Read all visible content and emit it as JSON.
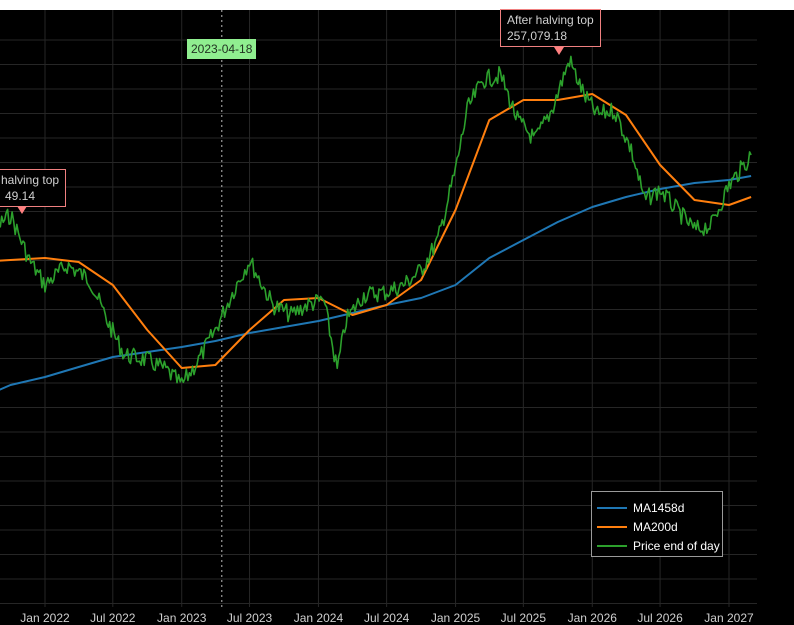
{
  "chart_data": {
    "type": "line",
    "x_ticks": [
      "Jan 2022",
      "Jul 2022",
      "Jan 2023",
      "Jul 2023",
      "Jan 2024",
      "Jul 2024",
      "Jan 2025",
      "Jul 2025",
      "Jan 2026",
      "Jul 2026",
      "Jan 2027"
    ],
    "vertical_marker": {
      "date": "2023-04-18",
      "label": "2023-04-18"
    },
    "annotations": [
      {
        "label": "halving top",
        "value_text": "49.14",
        "name": "left-halving-top"
      },
      {
        "label": "After halving top",
        "value_text": "257,079.18",
        "name": "after-halving-top"
      }
    ],
    "legend": {
      "placement": "bottom-right"
    },
    "grid": true,
    "series": [
      {
        "name": "MA1458d",
        "color": "#1f77b4",
        "points": [
          [
            "2021-07-01",
            400
          ],
          [
            "2021-10-01",
            385
          ],
          [
            "2022-01-01",
            377
          ],
          [
            "2022-04-01",
            367
          ],
          [
            "2022-07-01",
            357
          ],
          [
            "2022-10-01",
            352
          ],
          [
            "2023-01-01",
            347
          ],
          [
            "2023-04-01",
            341
          ],
          [
            "2023-07-01",
            333
          ],
          [
            "2023-10-01",
            327
          ],
          [
            "2024-01-01",
            321
          ],
          [
            "2024-04-01",
            313
          ],
          [
            "2024-07-01",
            305
          ],
          [
            "2024-10-01",
            298
          ],
          [
            "2025-01-01",
            285
          ],
          [
            "2025-04-01",
            258
          ],
          [
            "2025-07-01",
            240
          ],
          [
            "2025-10-01",
            222
          ],
          [
            "2026-01-01",
            207
          ],
          [
            "2026-04-01",
            197
          ],
          [
            "2026-07-01",
            189
          ],
          [
            "2026-10-01",
            183
          ],
          [
            "2027-01-01",
            180
          ],
          [
            "2027-03-01",
            176
          ]
        ]
      },
      {
        "name": "MA200d",
        "color": "#ff7f0e",
        "points": [
          [
            "2021-07-01",
            262
          ],
          [
            "2021-10-01",
            260
          ],
          [
            "2022-01-01",
            258
          ],
          [
            "2022-04-01",
            262
          ],
          [
            "2022-07-01",
            285
          ],
          [
            "2022-10-01",
            330
          ],
          [
            "2023-01-01",
            368
          ],
          [
            "2023-04-01",
            365
          ],
          [
            "2023-07-01",
            330
          ],
          [
            "2023-10-01",
            300
          ],
          [
            "2024-01-01",
            298
          ],
          [
            "2024-04-01",
            315
          ],
          [
            "2024-07-01",
            305
          ],
          [
            "2024-10-01",
            280
          ],
          [
            "2025-01-01",
            210
          ],
          [
            "2025-04-01",
            120
          ],
          [
            "2025-07-01",
            100
          ],
          [
            "2025-10-01",
            100
          ],
          [
            "2026-01-01",
            94
          ],
          [
            "2026-04-01",
            115
          ],
          [
            "2026-07-01",
            165
          ],
          [
            "2026-10-01",
            200
          ],
          [
            "2027-01-01",
            205
          ],
          [
            "2027-03-01",
            197
          ]
        ]
      },
      {
        "name": "Price end of day",
        "color": "#2ca02c",
        "points": [
          [
            "2021-07-01",
            265
          ],
          [
            "2021-08-15",
            230
          ],
          [
            "2021-10-01",
            215
          ],
          [
            "2021-11-20",
            260
          ],
          [
            "2022-01-01",
            285
          ],
          [
            "2022-03-01",
            265
          ],
          [
            "2022-05-01",
            280
          ],
          [
            "2022-06-15",
            320
          ],
          [
            "2022-08-01",
            355
          ],
          [
            "2022-10-01",
            360
          ],
          [
            "2022-11-20",
            370
          ],
          [
            "2023-01-01",
            385
          ],
          [
            "2023-02-15",
            360
          ],
          [
            "2023-04-01",
            330
          ],
          [
            "2023-05-20",
            290
          ],
          [
            "2023-07-01",
            260
          ],
          [
            "2023-09-01",
            305
          ],
          [
            "2023-10-20",
            315
          ],
          [
            "2023-12-01",
            305
          ],
          [
            "2024-01-15",
            300
          ],
          [
            "2024-02-20",
            370
          ],
          [
            "2024-03-15",
            320
          ],
          [
            "2024-05-01",
            295
          ],
          [
            "2024-07-01",
            292
          ],
          [
            "2024-08-15",
            285
          ],
          [
            "2024-10-01",
            270
          ],
          [
            "2024-11-15",
            240
          ],
          [
            "2025-01-01",
            170
          ],
          [
            "2025-02-01",
            110
          ],
          [
            "2025-03-15",
            80
          ],
          [
            "2025-05-01",
            75
          ],
          [
            "2025-06-15",
            120
          ],
          [
            "2025-08-01",
            140
          ],
          [
            "2025-09-15",
            110
          ],
          [
            "2025-11-01",
            60
          ],
          [
            "2025-12-10",
            95
          ],
          [
            "2026-01-15",
            115
          ],
          [
            "2026-03-01",
            110
          ],
          [
            "2026-04-15",
            150
          ],
          [
            "2026-05-20",
            200
          ],
          [
            "2026-07-01",
            190
          ],
          [
            "2026-08-15",
            210
          ],
          [
            "2026-10-01",
            230
          ],
          [
            "2026-11-15",
            225
          ],
          [
            "2027-01-01",
            185
          ],
          [
            "2027-02-01",
            170
          ],
          [
            "2027-03-01",
            155
          ]
        ]
      }
    ]
  }
}
